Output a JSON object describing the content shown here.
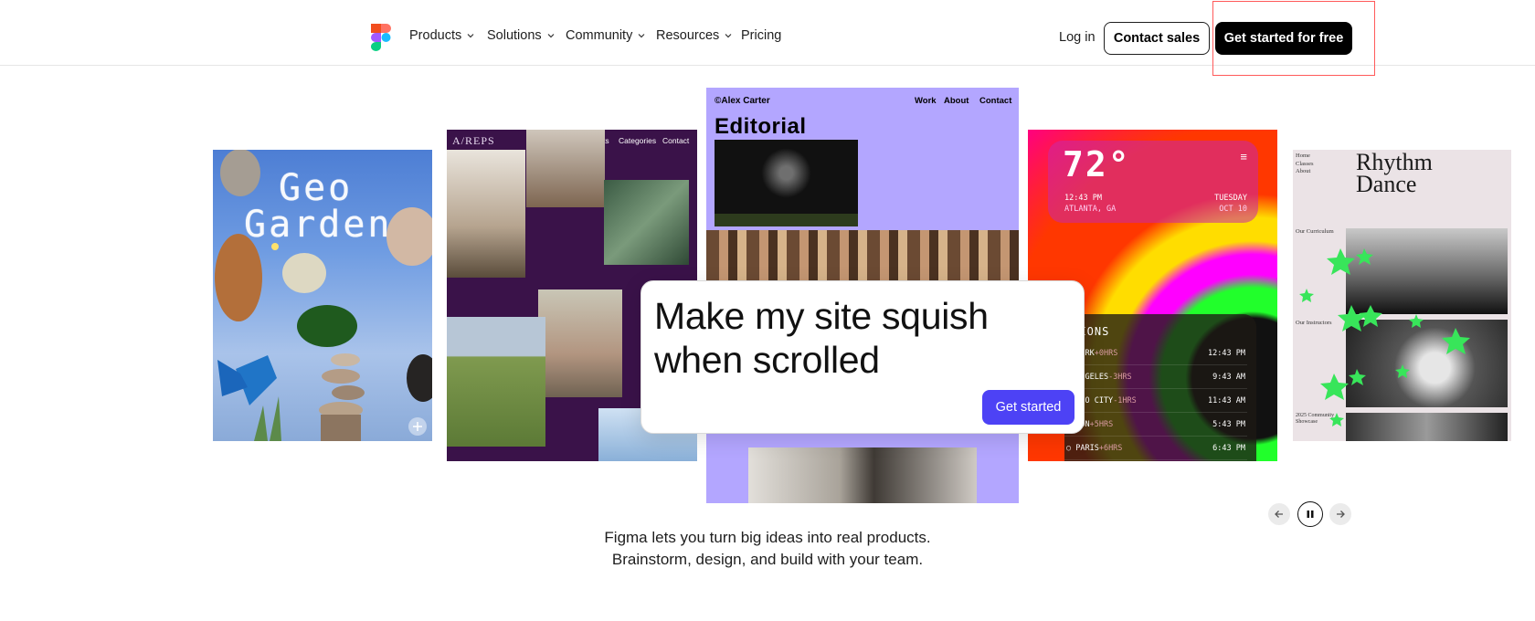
{
  "header": {
    "nav": [
      {
        "label": "Products",
        "dropdown": true
      },
      {
        "label": "Solutions",
        "dropdown": true
      },
      {
        "label": "Community",
        "dropdown": true
      },
      {
        "label": "Resources",
        "dropdown": true
      },
      {
        "label": "Pricing",
        "dropdown": false
      }
    ],
    "login_label": "Log in",
    "contact_label": "Contact sales",
    "cta_label": "Get started for free"
  },
  "cards": {
    "geo": {
      "title_line1": "Geo",
      "title_line2": "Garden"
    },
    "areps": {
      "brand": "A/REPS",
      "nav": [
        "Artists",
        "Categories",
        "Contact"
      ]
    },
    "editorial": {
      "author": "©Alex Carter",
      "nav": [
        "Work",
        "About",
        "Contact"
      ],
      "title": "Editorial"
    },
    "weather": {
      "temp": "72°",
      "time": "12:43 PM",
      "place": "ATLANTA, GA",
      "day": "TUESDAY",
      "date": "OCT 10",
      "locations_title": "ATIONS",
      "rows": [
        {
          "city": "W YORK",
          "offset": "+0HRS",
          "time": "12:43 PM"
        },
        {
          "city": "S ANGELES",
          "offset": "-3HRS",
          "time": "9:43 AM"
        },
        {
          "city": "EXICO CITY",
          "offset": "-1HRS",
          "time": "11:43 AM"
        },
        {
          "city": "ONDON",
          "offset": "+5HRS",
          "time": "5:43 PM"
        },
        {
          "city": "○ PARIS",
          "offset": "+6HRS",
          "time": "6:43 PM"
        }
      ]
    },
    "rhythm": {
      "menu": [
        "Home",
        "Classes",
        "About"
      ],
      "title_line1": "Rhythm",
      "title_line2": "Dance",
      "sections": [
        "Our Curriculum",
        "Our Instructors",
        "2025 Community Showcase"
      ]
    }
  },
  "prompt": {
    "line1": "Make my site squish",
    "line2": "when scrolled",
    "button": "Get started"
  },
  "tagline": {
    "line1": "Figma lets you turn big ideas into real products.",
    "line2": "Brainstorm, design, and build with your team."
  },
  "colors": {
    "accent": "#4d42f5",
    "highlight": "#ff5a5a",
    "editorial_bg": "#b3a6ff",
    "areps_bg": "#3a1249"
  }
}
